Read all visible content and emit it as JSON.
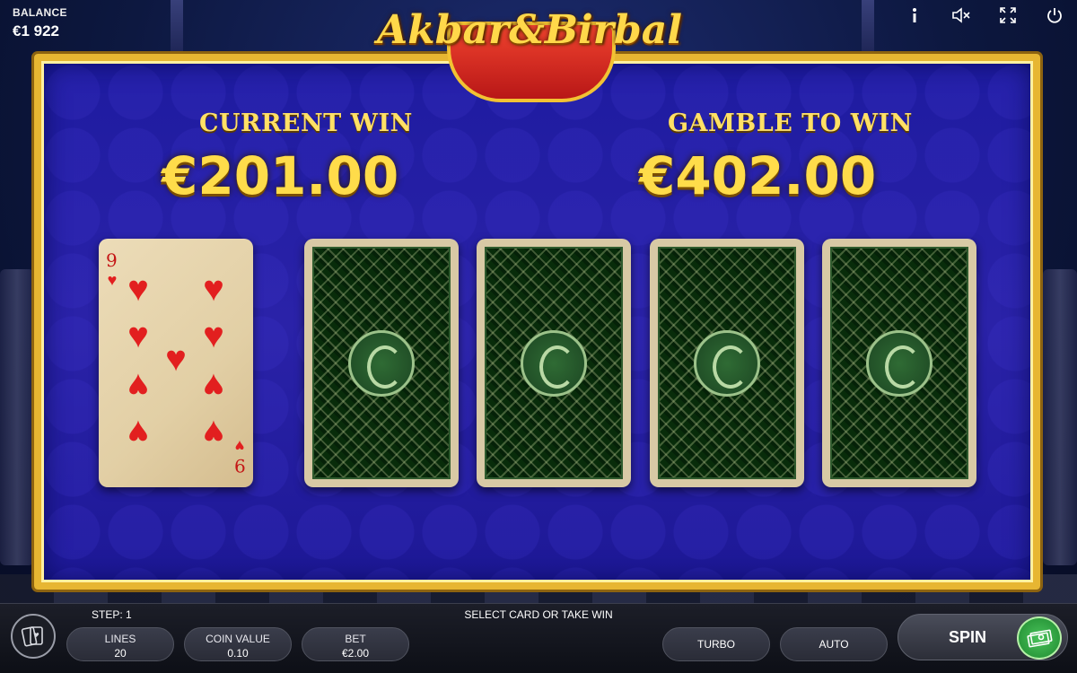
{
  "header": {
    "balance_label": "BALANCE",
    "balance_value": "€1 922",
    "logo_text": "Akbar&Birbal",
    "icons": [
      "info-icon",
      "mute-icon",
      "fullscreen-icon",
      "power-icon"
    ]
  },
  "gamble": {
    "current_win_label": "CURRENT WIN",
    "current_win_value": "€201.00",
    "gamble_to_win_label": "GAMBLE TO WIN",
    "gamble_to_win_value": "€402.00",
    "revealed_card": {
      "rank": "9",
      "suit": "hearts",
      "color": "#e21f1f"
    },
    "face_down_cards": 4
  },
  "bottom": {
    "step": "STEP: 1",
    "message": "SELECT CARD OR TAKE WIN",
    "lines_label": "LINES",
    "lines_value": "20",
    "coin_label": "COIN VALUE",
    "coin_value": "0.10",
    "bet_label": "BET",
    "bet_value": "€2.00",
    "turbo_label": "TURBO",
    "auto_label": "AUTO",
    "spin_label": "SPIN"
  },
  "colors": {
    "gold": "#e7b632",
    "panel_blue": "#2a22a8",
    "card_back_green": "#2d6a33",
    "heart_red": "#e21f1f",
    "spin_green": "#49c25a"
  }
}
